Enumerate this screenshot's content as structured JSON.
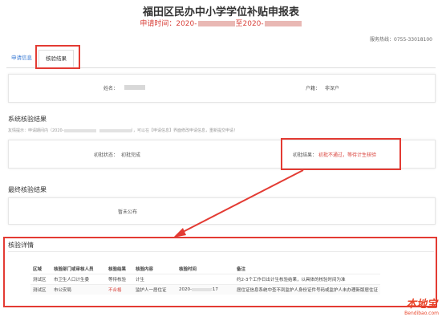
{
  "header": {
    "title": "福田区民办中小学学位补贴申报表",
    "apply_time_prefix": "申请时间：2020-",
    "apply_time_mid": "至2020-",
    "hotline": "服务热线：0755-33018100"
  },
  "tabs": {
    "info": "申请信息",
    "result": "核验结果"
  },
  "basic": {
    "name_label": "姓名：",
    "hukou_label": "户籍：",
    "hukou_value": "非深户"
  },
  "system_check": {
    "title": "系统核验结果",
    "note_a": "友情提示：申请期间内（2020-",
    "note_b": "），可以在【申请信息】界面修改申请信息，重新提交申请！",
    "first_status_label": "初批状态：",
    "first_status_value": "初批完成",
    "first_result_label": "初批结果：",
    "first_result_value": "初批不通过，等待计生核验"
  },
  "final_check": {
    "title": "最终核验结果",
    "value": "暂未公布"
  },
  "details": {
    "title": "核验详情",
    "headers": [
      "区域",
      "核验部门或审核人员",
      "核验结果",
      "核验内容",
      "核验时间",
      "备注"
    ],
    "rows": [
      {
        "area": "测试区",
        "dept": "市卫生人口计生委",
        "result": "等待核验",
        "content": "计生",
        "time": "",
        "remark": "约2-3个工作日出计生核验结果，以具体的核验时间为准"
      },
      {
        "area": "测试区",
        "dept": "市公安局",
        "result": "不合格",
        "content": "监护人一居住证",
        "time": "2020-",
        "time_tail": ":17",
        "remark": "居住证信息系统中查不到监护人身份证件号码或监护人未办理新版居住证"
      }
    ]
  },
  "watermark": {
    "main": "本地宝",
    "sub": "Bendibao.com"
  },
  "colors": {
    "accent_red": "#e33b33",
    "link_blue": "#3a7bd5"
  }
}
